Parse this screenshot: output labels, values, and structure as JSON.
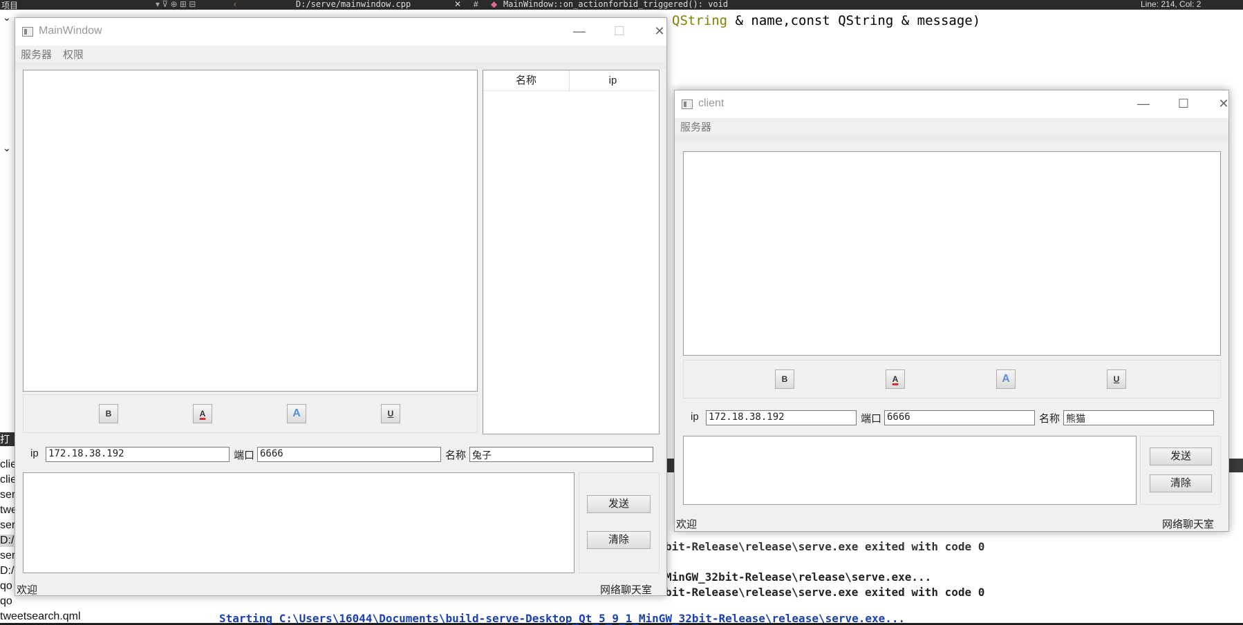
{
  "ide": {
    "top_project_label": "项目",
    "top_file_path": "D:/serve/mainwindow.cpp",
    "top_symbol": "MainWindow::on_actionforbid_triggered(): void",
    "top_line_col": "Line: 214, Col: 2",
    "code_line": "& name,const QString & message)",
    "code_line_prefix": "QString",
    "project_items": [
      "clie",
      "clie",
      "ser",
      "twe",
      "ser",
      "D:/",
      "ser",
      "D:/",
      "qo",
      "qo",
      "tweetsearch.qml"
    ],
    "project_header": "打开",
    "output_lines": [
      "bit-Release\\release\\serve.exe exited with code 0",
      "MinGW_32bit-Release\\release\\serve.exe...",
      "bit-Release\\release\\serve.exe exited with code 0",
      "Starting C:\\Users\\16044\\Documents\\build-serve-Desktop_Qt_5_9_1_MinGW_32bit-Release\\release\\serve.exe..."
    ]
  },
  "server_window": {
    "title": "MainWindow",
    "menu": [
      "服务器",
      "权限"
    ],
    "table_headers": [
      "名称",
      "ip"
    ],
    "format_buttons": [
      "B",
      "A",
      "A",
      "U"
    ],
    "ip_label": "ip",
    "ip_value": "172.18.38.192",
    "port_label": "端口",
    "port_value": "6666",
    "name_label": "名称",
    "name_value": "兔子",
    "send_label": "发送",
    "clear_label": "清除",
    "status_left": "欢迎",
    "status_right": "网络聊天室"
  },
  "client_window": {
    "title": "client",
    "menu": [
      "服务器"
    ],
    "format_buttons": [
      "B",
      "A",
      "A",
      "U"
    ],
    "ip_label": "ip",
    "ip_value": "172.18.38.192",
    "port_label": "端口",
    "port_value": "6666",
    "name_label": "名称",
    "name_value": "熊猫",
    "send_label": "发送",
    "clear_label": "清除",
    "status_left": "欢迎",
    "status_right": "网络聊天室"
  },
  "colors": {
    "font_color_underline": "#d32f2f",
    "highlight_icon": "#5a8fd6"
  }
}
